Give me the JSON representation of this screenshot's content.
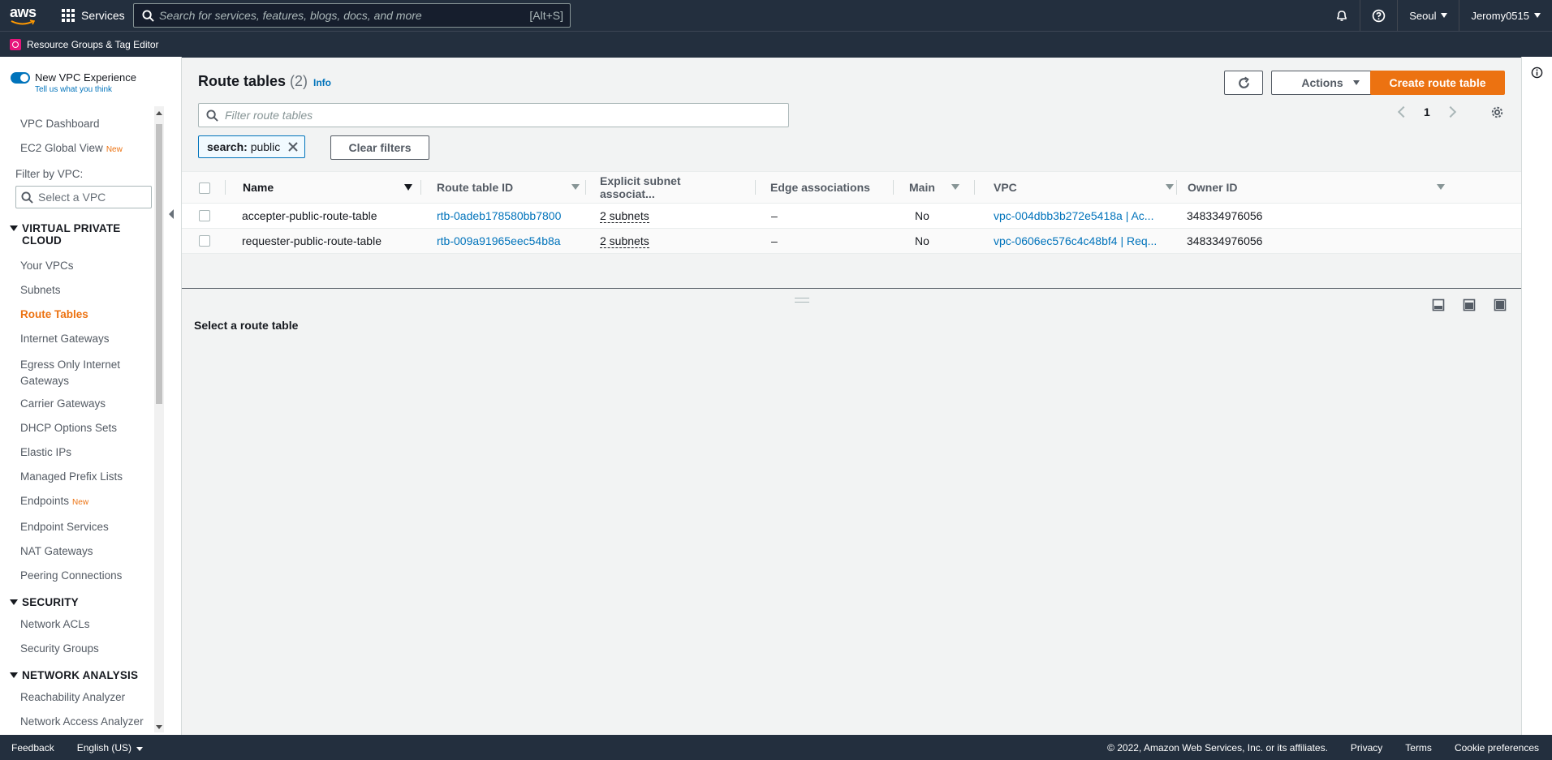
{
  "topnav": {
    "logo_text": "aws",
    "services_label": "Services",
    "search_placeholder": "Search for services, features, blogs, docs, and more",
    "search_shortcut": "[Alt+S]",
    "region": "Seoul",
    "account": "Jeromy0515"
  },
  "secondnav": {
    "label": "Resource Groups & Tag Editor"
  },
  "sidebar": {
    "new_vpc_label": "New VPC Experience",
    "feedback_link": "Tell us what you think",
    "dashboard": "VPC Dashboard",
    "global_view": "EC2 Global View",
    "new_badge": "New",
    "filter_label": "Filter by VPC:",
    "vpc_select_placeholder": "Select a VPC",
    "section_vpc": "VIRTUAL PRIVATE CLOUD",
    "vpc_items": [
      "Your VPCs",
      "Subnets",
      "Route Tables",
      "Internet Gateways",
      "Egress Only Internet Gateways",
      "Carrier Gateways",
      "DHCP Options Sets",
      "Elastic IPs",
      "Managed Prefix Lists",
      "Endpoints",
      "Endpoint Services",
      "NAT Gateways",
      "Peering Connections"
    ],
    "section_security": "SECURITY",
    "security_items": [
      "Network ACLs",
      "Security Groups"
    ],
    "section_network": "NETWORK ANALYSIS",
    "network_items": [
      "Reachability Analyzer",
      "Network Access Analyzer"
    ]
  },
  "main": {
    "title": "Route tables",
    "count": "(2)",
    "info": "Info",
    "actions_label": "Actions",
    "create_label": "Create route table",
    "filter_placeholder": "Filter route tables",
    "page_number": "1",
    "token_key": "search:",
    "token_value": "public",
    "clear_filters": "Clear filters",
    "columns": [
      "Name",
      "Route table ID",
      "Explicit subnet associat...",
      "Edge associations",
      "Main",
      "VPC",
      "Owner ID"
    ],
    "rows": [
      {
        "name": "accepter-public-route-table",
        "id": "rtb-0adeb178580bb7800",
        "subnets": "2 subnets",
        "edge": "–",
        "main": "No",
        "vpc": "vpc-004dbb3b272e5418a | Ac...",
        "owner": "348334976056"
      },
      {
        "name": "requester-public-route-table",
        "id": "rtb-009a91965eec54b8a",
        "subnets": "2 subnets",
        "edge": "–",
        "main": "No",
        "vpc": "vpc-0606ec576c4c48bf4 | Req...",
        "owner": "348334976056"
      }
    ],
    "select_message": "Select a route table"
  },
  "footer": {
    "feedback": "Feedback",
    "language": "English (US)",
    "copyright": "© 2022, Amazon Web Services, Inc. or its affiliates.",
    "privacy": "Privacy",
    "terms": "Terms",
    "cookies": "Cookie preferences"
  },
  "colors": {
    "nav_bg": "#232f3e",
    "accent_orange": "#ec7211",
    "link_blue": "#0073bb"
  },
  "icons": [
    "aws-logo",
    "grid-icon",
    "search-icon",
    "bell-icon",
    "help-icon",
    "resource-groups-icon",
    "refresh-icon",
    "settings-gear-icon",
    "info-circle-icon",
    "close-icon",
    "chevron-left-icon",
    "chevron-right-icon"
  ]
}
